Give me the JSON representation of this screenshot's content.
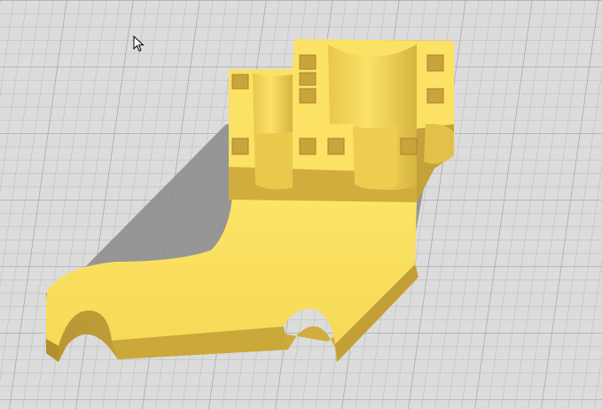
{
  "viewport": {
    "background_color": "#dcdcdc",
    "grid_line_color": "#b3b3b3",
    "grid_major_line_color": "#9d9d9d"
  },
  "model": {
    "top_color": "#f9e05d",
    "side_color": "#d6b43a",
    "dark_color": "#b69532",
    "shadow_color": "#8f8f8f",
    "hole_color": "#c9a43b"
  },
  "cursor": {
    "icon": "arrow-cursor-icon"
  }
}
